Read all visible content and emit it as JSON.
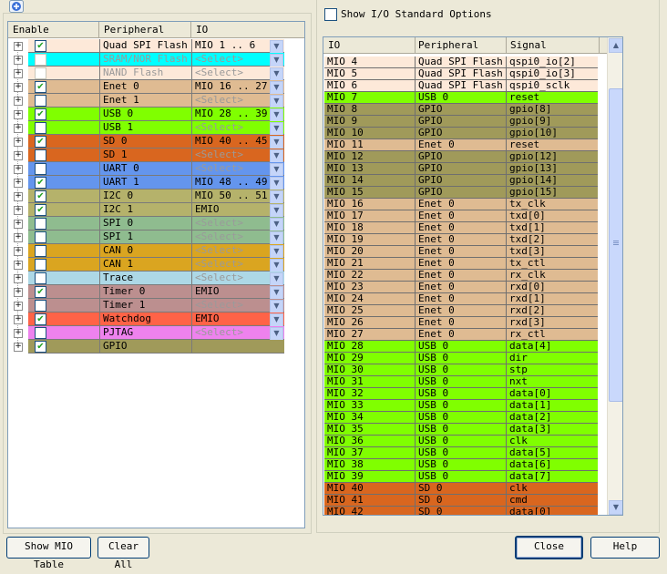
{
  "toolbar": {
    "add_icon": "plus-circle-icon"
  },
  "left_table": {
    "headers": [
      "Enable",
      "Peripheral",
      "IO"
    ],
    "rows": [
      {
        "name": "Quad SPI Flash",
        "io": "MIO 1 .. 6",
        "enabled": true,
        "active": true,
        "color": "#fde9d9"
      },
      {
        "name": "SRAM/NOR Flash",
        "io": "<Select>",
        "enabled": false,
        "active": false,
        "color": "#00ffff"
      },
      {
        "name": "NAND Flash",
        "io": "<Select>",
        "enabled": false,
        "active": false,
        "color": "#fde9d9"
      },
      {
        "name": "Enet 0",
        "io": "MIO 16 .. 27",
        "enabled": true,
        "active": true,
        "color": "#dfbb92"
      },
      {
        "name": "Enet 1",
        "io": "<Select>",
        "enabled": false,
        "active": true,
        "color": "#dfbb92"
      },
      {
        "name": "USB 0",
        "io": "MIO 28 .. 39",
        "enabled": true,
        "active": true,
        "color": "#80ff00"
      },
      {
        "name": "USB 1",
        "io": "<Select>",
        "enabled": false,
        "active": true,
        "color": "#80ff00"
      },
      {
        "name": "SD 0",
        "io": "MIO 40 .. 45",
        "enabled": true,
        "active": true,
        "color": "#d9661f"
      },
      {
        "name": "SD 1",
        "io": "<Select>",
        "enabled": false,
        "active": true,
        "color": "#d9661f"
      },
      {
        "name": "UART 0",
        "io": "<Select>",
        "enabled": false,
        "active": true,
        "color": "#6495ed"
      },
      {
        "name": "UART 1",
        "io": "MIO 48 .. 49",
        "enabled": true,
        "active": true,
        "color": "#6495ed"
      },
      {
        "name": "I2C 0",
        "io": "MIO 50 .. 51",
        "enabled": true,
        "active": true,
        "color": "#b5b26b"
      },
      {
        "name": "I2C 1",
        "io": "EMIO",
        "enabled": true,
        "active": true,
        "color": "#b5b26b"
      },
      {
        "name": "SPI 0",
        "io": "<Select>",
        "enabled": false,
        "active": true,
        "color": "#8fbc8f"
      },
      {
        "name": "SPI 1",
        "io": "<Select>",
        "enabled": false,
        "active": true,
        "color": "#8fbc8f"
      },
      {
        "name": "CAN 0",
        "io": "<Select>",
        "enabled": false,
        "active": true,
        "color": "#daa520"
      },
      {
        "name": "CAN 1",
        "io": "<Select>",
        "enabled": false,
        "active": true,
        "color": "#daa520"
      },
      {
        "name": "Trace",
        "io": "<Select>",
        "enabled": false,
        "active": true,
        "color": "#add8e6"
      },
      {
        "name": "Timer 0",
        "io": "EMIO",
        "enabled": true,
        "active": true,
        "color": "#bc8f8f"
      },
      {
        "name": "Timer 1",
        "io": "<Select>",
        "enabled": false,
        "active": true,
        "color": "#bc8f8f"
      },
      {
        "name": "Watchdog",
        "io": "EMIO",
        "enabled": true,
        "active": true,
        "color": "#ff6347"
      },
      {
        "name": "PJTAG",
        "io": "<Select>",
        "enabled": false,
        "active": true,
        "color": "#ee82ee"
      },
      {
        "name": "GPIO",
        "io": "",
        "enabled": true,
        "active": true,
        "color": "#a09a5a"
      }
    ]
  },
  "io_standard": {
    "label": "Show I/O Standard Options"
  },
  "right_table": {
    "headers": [
      "IO",
      "Peripheral",
      "Signal"
    ],
    "rows": [
      [
        "MIO 4",
        "Quad SPI Flash",
        "qspi0_io[2]",
        "#fde9d9"
      ],
      [
        "MIO 5",
        "Quad SPI Flash",
        "qspi0_io[3]",
        "#fde9d9"
      ],
      [
        "MIO 6",
        "Quad SPI Flash",
        "qspi0_sclk",
        "#fde9d9"
      ],
      [
        "MIO 7",
        "USB 0",
        "reset",
        "#80ff00"
      ],
      [
        "MIO 8",
        "GPIO",
        "gpio[8]",
        "#a09a5a"
      ],
      [
        "MIO 9",
        "GPIO",
        "gpio[9]",
        "#a09a5a"
      ],
      [
        "MIO 10",
        "GPIO",
        "gpio[10]",
        "#a09a5a"
      ],
      [
        "MIO 11",
        "Enet 0",
        "reset",
        "#dfbb92"
      ],
      [
        "MIO 12",
        "GPIO",
        "gpio[12]",
        "#a09a5a"
      ],
      [
        "MIO 13",
        "GPIO",
        "gpio[13]",
        "#a09a5a"
      ],
      [
        "MIO 14",
        "GPIO",
        "gpio[14]",
        "#a09a5a"
      ],
      [
        "MIO 15",
        "GPIO",
        "gpio[15]",
        "#a09a5a"
      ],
      [
        "MIO 16",
        "Enet 0",
        "tx_clk",
        "#dfbb92"
      ],
      [
        "MIO 17",
        "Enet 0",
        "txd[0]",
        "#dfbb92"
      ],
      [
        "MIO 18",
        "Enet 0",
        "txd[1]",
        "#dfbb92"
      ],
      [
        "MIO 19",
        "Enet 0",
        "txd[2]",
        "#dfbb92"
      ],
      [
        "MIO 20",
        "Enet 0",
        "txd[3]",
        "#dfbb92"
      ],
      [
        "MIO 21",
        "Enet 0",
        "tx_ctl",
        "#dfbb92"
      ],
      [
        "MIO 22",
        "Enet 0",
        "rx_clk",
        "#dfbb92"
      ],
      [
        "MIO 23",
        "Enet 0",
        "rxd[0]",
        "#dfbb92"
      ],
      [
        "MIO 24",
        "Enet 0",
        "rxd[1]",
        "#dfbb92"
      ],
      [
        "MIO 25",
        "Enet 0",
        "rxd[2]",
        "#dfbb92"
      ],
      [
        "MIO 26",
        "Enet 0",
        "rxd[3]",
        "#dfbb92"
      ],
      [
        "MIO 27",
        "Enet 0",
        "rx_ctl",
        "#dfbb92"
      ],
      [
        "MIO 28",
        "USB 0",
        "data[4]",
        "#80ff00"
      ],
      [
        "MIO 29",
        "USB 0",
        "dir",
        "#80ff00"
      ],
      [
        "MIO 30",
        "USB 0",
        "stp",
        "#80ff00"
      ],
      [
        "MIO 31",
        "USB 0",
        "nxt",
        "#80ff00"
      ],
      [
        "MIO 32",
        "USB 0",
        "data[0]",
        "#80ff00"
      ],
      [
        "MIO 33",
        "USB 0",
        "data[1]",
        "#80ff00"
      ],
      [
        "MIO 34",
        "USB 0",
        "data[2]",
        "#80ff00"
      ],
      [
        "MIO 35",
        "USB 0",
        "data[3]",
        "#80ff00"
      ],
      [
        "MIO 36",
        "USB 0",
        "clk",
        "#80ff00"
      ],
      [
        "MIO 37",
        "USB 0",
        "data[5]",
        "#80ff00"
      ],
      [
        "MIO 38",
        "USB 0",
        "data[6]",
        "#80ff00"
      ],
      [
        "MIO 39",
        "USB 0",
        "data[7]",
        "#80ff00"
      ],
      [
        "MIO 40",
        "SD 0",
        "clk",
        "#d9661f"
      ],
      [
        "MIO 41",
        "SD 0",
        "cmd",
        "#d9661f"
      ],
      [
        "MIO 42",
        "SD 0",
        "data[0]",
        "#d9661f"
      ]
    ]
  },
  "buttons": {
    "show_mio_table": "Show MIO Table",
    "clear_all": "Clear All",
    "close": "Close",
    "help": "Help"
  }
}
